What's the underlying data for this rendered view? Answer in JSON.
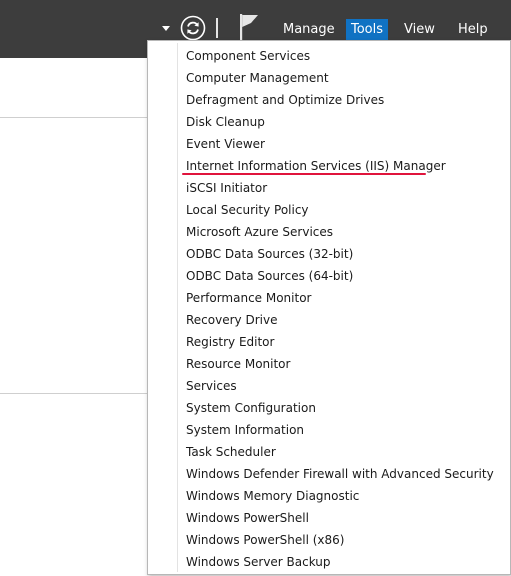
{
  "header": {
    "nav": {
      "manage": "Manage",
      "tools": "Tools",
      "view": "View",
      "help": "Help"
    },
    "icons": [
      "chevron-down-icon",
      "refresh-icon",
      "notifications-flag-icon"
    ],
    "accent_color": "#1072c3"
  },
  "tools_menu": {
    "items": [
      "Component Services",
      "Computer Management",
      "Defragment and Optimize Drives",
      "Disk Cleanup",
      "Event Viewer",
      "Internet Information Services (IIS) Manager",
      "iSCSI Initiator",
      "Local Security Policy",
      "Microsoft Azure Services",
      "ODBC Data Sources (32-bit)",
      "ODBC Data Sources (64-bit)",
      "Performance Monitor",
      "Recovery Drive",
      "Registry Editor",
      "Resource Monitor",
      "Services",
      "System Configuration",
      "System Information",
      "Task Scheduler",
      "Windows Defender Firewall with Advanced Security",
      "Windows Memory Diagnostic",
      "Windows PowerShell",
      "Windows PowerShell (x86)",
      "Windows Server Backup"
    ],
    "highlighted_item": "Internet Information Services (IIS) Manager",
    "highlight_color": "#e0143c"
  }
}
